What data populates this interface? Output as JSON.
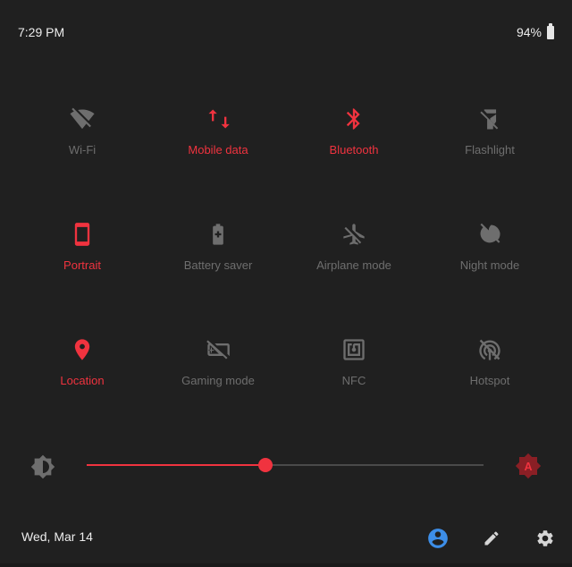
{
  "status": {
    "time": "7:29 PM",
    "battery": "94%"
  },
  "accent": "#f0333f",
  "tiles": [
    {
      "label": "Wi-Fi",
      "icon": "wifi-off-icon",
      "on": false
    },
    {
      "label": "Mobile data",
      "icon": "mobile-data-icon",
      "on": true
    },
    {
      "label": "Bluetooth",
      "icon": "bluetooth-icon",
      "on": true
    },
    {
      "label": "Flashlight",
      "icon": "flashlight-off-icon",
      "on": false
    },
    {
      "label": "Portrait",
      "icon": "screen-rotation-portrait-icon",
      "on": true
    },
    {
      "label": "Battery saver",
      "icon": "battery-saver-icon",
      "on": false
    },
    {
      "label": "Airplane mode",
      "icon": "airplane-off-icon",
      "on": false
    },
    {
      "label": "Night mode",
      "icon": "night-mode-off-icon",
      "on": false
    },
    {
      "label": "Location",
      "icon": "location-pin-icon",
      "on": true
    },
    {
      "label": "Gaming mode",
      "icon": "gaming-mode-off-icon",
      "on": false
    },
    {
      "label": "NFC",
      "icon": "nfc-icon",
      "on": false
    },
    {
      "label": "Hotspot",
      "icon": "hotspot-off-icon",
      "on": false
    }
  ],
  "brightness": {
    "level": 0.45,
    "auto_label": "A"
  },
  "footer": {
    "date": "Wed, Mar 14"
  }
}
